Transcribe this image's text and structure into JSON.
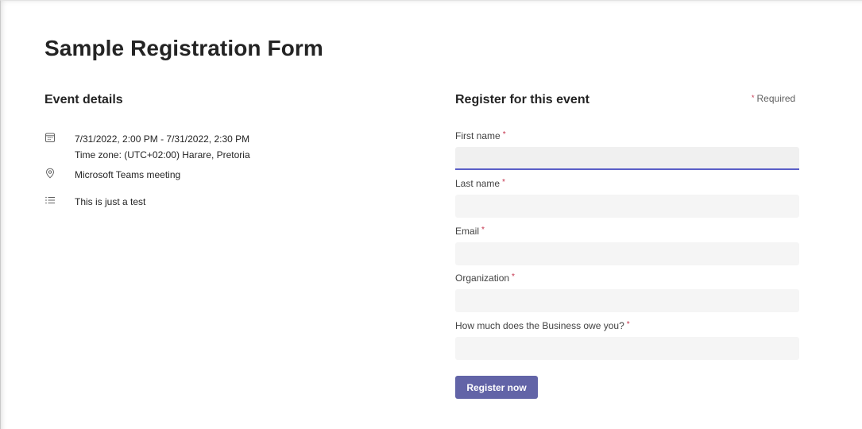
{
  "form": {
    "title": "Sample Registration Form"
  },
  "event_details": {
    "heading": "Event details",
    "date_range": "7/31/2022, 2:00 PM - 7/31/2022, 2:30 PM",
    "time_zone": "Time zone: (UTC+02:00) Harare, Pretoria",
    "location": "Microsoft Teams meeting",
    "description": "This is just a test",
    "icons": {
      "date": "calendar-icon",
      "location": "location-pin-icon",
      "description": "bulleted-list-icon"
    }
  },
  "registration": {
    "heading": "Register for this event",
    "required_marker": "*",
    "required_note": "Required",
    "fields": [
      {
        "label": "First name",
        "value": "",
        "placeholder": ""
      },
      {
        "label": "Last name",
        "value": "",
        "placeholder": ""
      },
      {
        "label": "Email",
        "value": "",
        "placeholder": ""
      },
      {
        "label": "Organization",
        "value": "",
        "placeholder": ""
      },
      {
        "label": "How much does the Business owe you?",
        "value": "",
        "placeholder": ""
      }
    ],
    "submit_label": "Register now"
  },
  "colors": {
    "accent": "#6264a7",
    "focus_underline": "#5b5fc7",
    "required_star": "#c4314b",
    "input_background": "#f5f5f5"
  }
}
